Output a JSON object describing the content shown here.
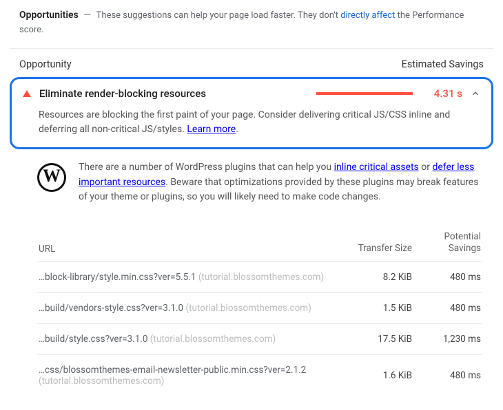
{
  "header": {
    "title": "Opportunities",
    "dash": "—",
    "desc_a": "These suggestions can help your page load faster. They don't ",
    "link_affect": "directly affect",
    "desc_b": " the Performance score."
  },
  "columns": {
    "opportunity": "Opportunity",
    "estimated_savings": "Estimated Savings"
  },
  "audit": {
    "title": "Eliminate render-blocking resources",
    "savings": "4.31 s",
    "desc_a": "Resources are blocking the first paint of your page. Consider delivering critical JS/CSS inline and deferring all non-critical JS/styles. ",
    "learn_more": "Learn more",
    "period": "."
  },
  "wp": {
    "t1": "There are a number of WordPress plugins that can help you ",
    "link1": "inline critical assets",
    "t2": " or ",
    "link2": "defer less important resources",
    "t3": ". Beware that optimizations provided by these plugins may break features of your theme or plugins, so you will likely need to make code changes."
  },
  "table": {
    "head": {
      "url": "URL",
      "size": "Transfer Size",
      "savings": "Potential Savings"
    },
    "rows": [
      {
        "path": "…block-library/style.min.css?ver=5.5.1",
        "origin": "(tutorial.blossomthemes.com)",
        "size": "8.2 KiB",
        "sav": "480 ms"
      },
      {
        "path": "…build/vendors-style.css?ver=3.1.0",
        "origin": "(tutorial.blossomthemes.com)",
        "size": "1.5 KiB",
        "sav": "480 ms"
      },
      {
        "path": "…build/style.css?ver=3.1.0",
        "origin": "(tutorial.blossomthemes.com)",
        "size": "17.5 KiB",
        "sav": "1,230 ms"
      },
      {
        "path": "…css/blossomthemes-email-newsletter-public.min.css?ver=2.1.2",
        "origin": "(tutorial.blossomthemes.com)",
        "size": "1.6 KiB",
        "sav": "480 ms"
      }
    ]
  }
}
